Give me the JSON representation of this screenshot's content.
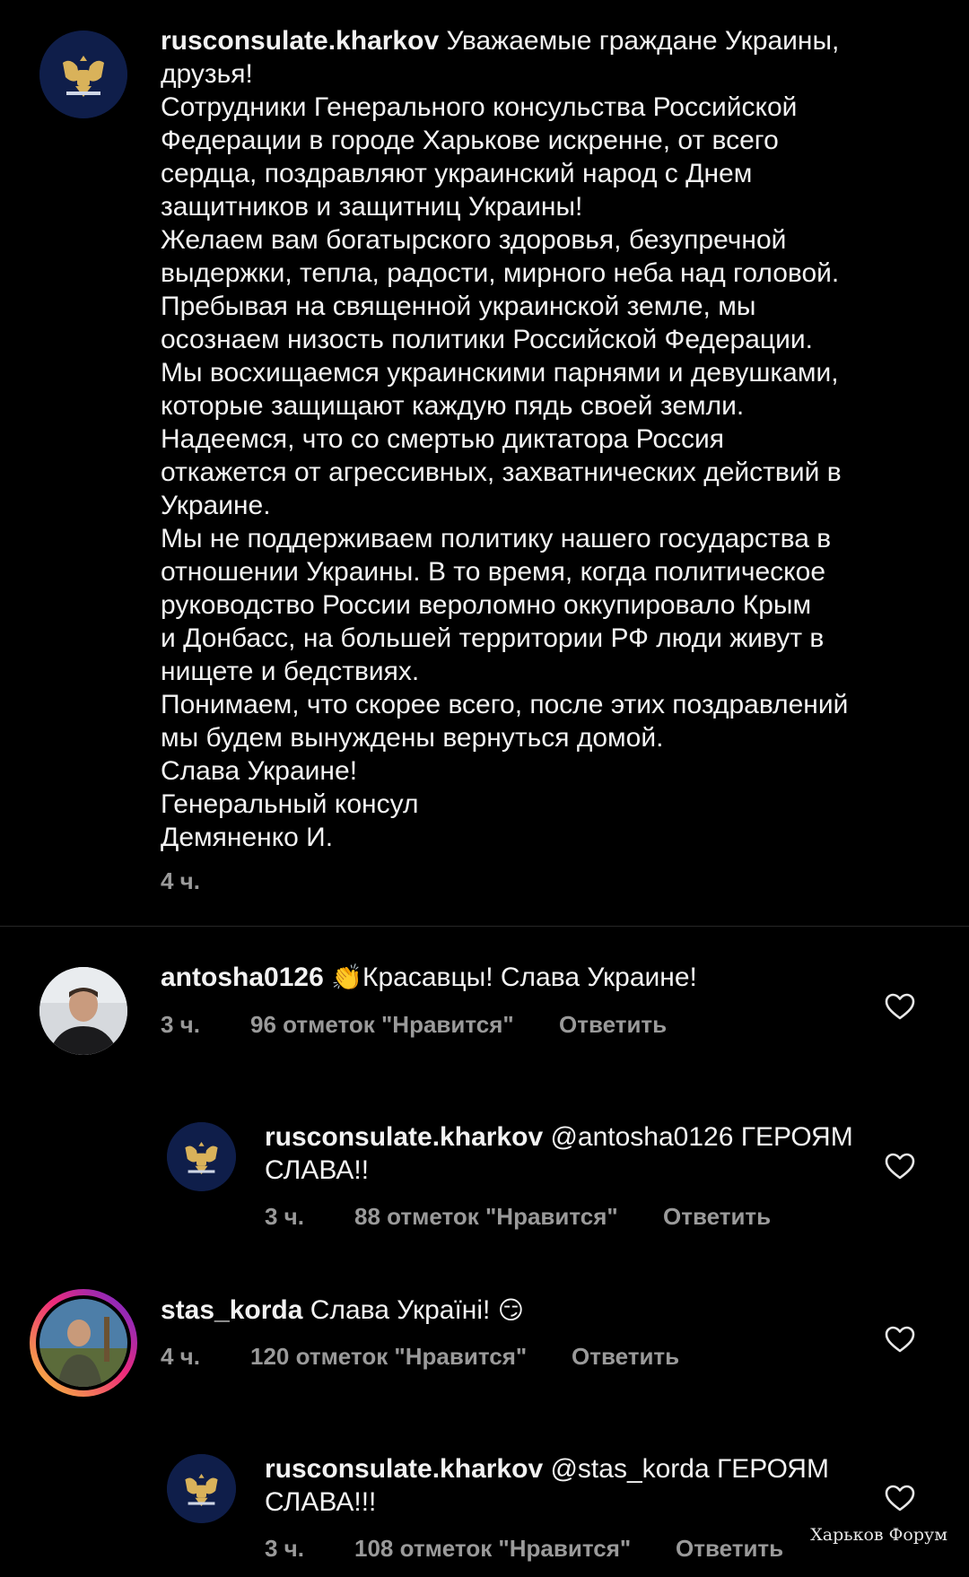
{
  "post": {
    "username": "rusconsulate.kharkov",
    "lines": [
      "Уважаемые граждане Украины,",
      "друзья!",
      "Сотрудники Генерального консульства Российской",
      "Федерации в городе Харькове искренне, от всего",
      "сердца, поздравляют украинский народ с Днем",
      "защитников и защитниц Украины!",
      "Желаем вам богатырского здоровья, безупречной",
      "выдержки, тепла, радости, мирного неба над головой.",
      "Пребывая на священной украинской земле, мы",
      "осознаем низость политики Российской Федерации.",
      "Мы восхищаемся украинскими парнями и девушками,",
      "которые защищают каждую пядь своей земли.",
      "Надеемся, что со смертью диктатора Россия",
      "откажется от агрессивных, захватнических действий в",
      "Украине.",
      "Мы не поддерживаем политику нашего государства в",
      "отношении Украины. В то время, когда политическое",
      "руководство России вероломно оккупировало Крым",
      "и Донбасс, на большей территории РФ люди живут в",
      "нищете и бедствиях.",
      "Понимаем, что скорее всего, после этих поздравлений",
      "мы будем вынуждены вернуться домой.",
      "Слава Украине!",
      "Генеральный консул",
      "Демяненко И."
    ],
    "time": "4 ч."
  },
  "comments": [
    {
      "username": "antosha0126",
      "emoji": "👏",
      "text": "Красавцы! Слава Украине!",
      "time": "3 ч.",
      "likes": "96 отметок \"Нравится\"",
      "reply": "Ответить"
    },
    {
      "username": "rusconsulate.kharkov",
      "text_line1": "@antosha0126 ГЕРОЯМ",
      "text_line2": "СЛАВА!!",
      "time": "3 ч.",
      "likes": "88 отметок \"Нравится\"",
      "reply": "Ответить"
    },
    {
      "username": "stas_korda",
      "text": "Слава Україні!",
      "emoji": "😏",
      "time": "4 ч.",
      "likes": "120 отметок \"Нравится\"",
      "reply": "Ответить"
    },
    {
      "username": "rusconsulate.kharkov",
      "text_line1": "@stas_korda ГЕРОЯМ",
      "text_line2": "СЛАВА!!!",
      "time": "3 ч.",
      "likes": "108 отметок \"Нравится\"",
      "reply": "Ответить"
    }
  ],
  "watermark": "Харьков Форум",
  "icons": {
    "consulate_avatar": "double-headed-eagle-emblem",
    "heart": "heart-outline-icon"
  },
  "colors": {
    "background": "#000000",
    "text": "#f2f2f2",
    "meta": "#9a9a9a",
    "avatar_navy": "#0f1e4a",
    "story_ring": "#e1306c"
  }
}
